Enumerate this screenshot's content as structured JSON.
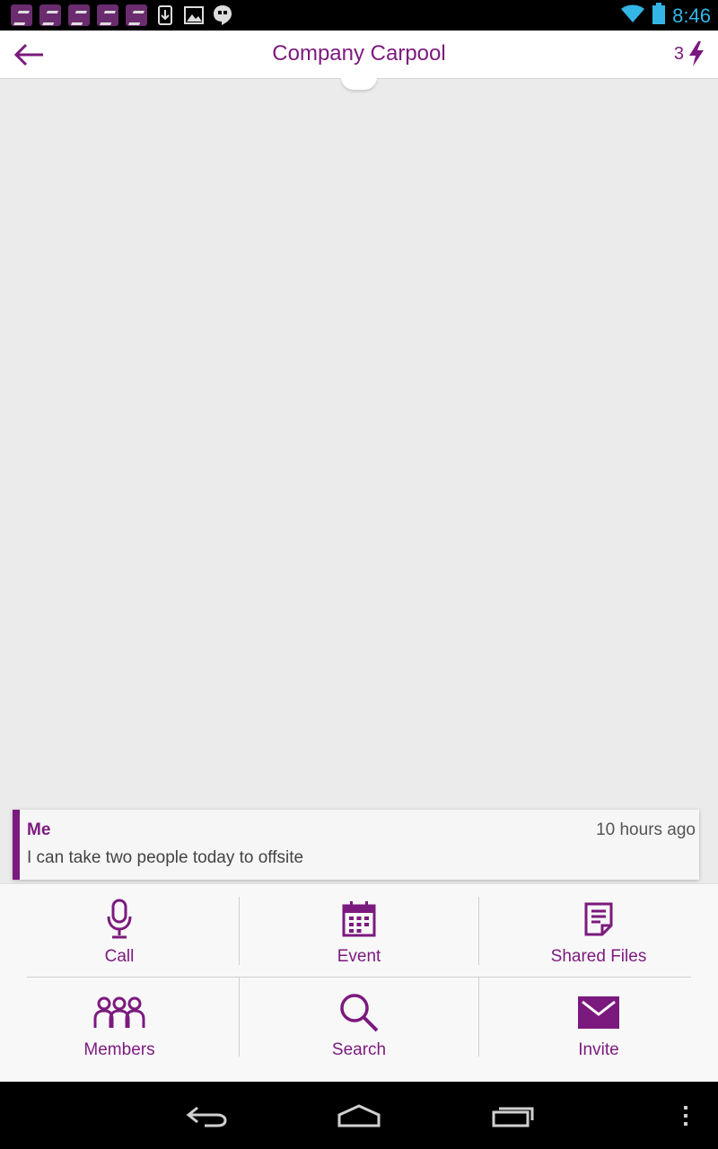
{
  "status_bar": {
    "time": "8:46",
    "notification_icons": [
      "app-notification-icon",
      "app-notification-icon",
      "app-notification-icon",
      "app-notification-icon",
      "app-notification-icon",
      "download-icon",
      "image-icon",
      "hangouts-icon"
    ],
    "system_icons": [
      "wifi-icon",
      "battery-icon"
    ]
  },
  "action_bar": {
    "title": "Company Carpool",
    "badge_count": "3",
    "back_icon": "back-arrow-icon",
    "badge_icon": "lightning-icon"
  },
  "message": {
    "sender": "Me",
    "time": "10 hours ago",
    "text": "I can take two people today to offsite"
  },
  "menu": {
    "items": [
      {
        "label": "Call",
        "icon": "microphone-icon"
      },
      {
        "label": "Event",
        "icon": "calendar-icon"
      },
      {
        "label": "Shared Files",
        "icon": "document-icon"
      },
      {
        "label": "Members",
        "icon": "people-icon"
      },
      {
        "label": "Search",
        "icon": "search-icon"
      },
      {
        "label": "Invite",
        "icon": "envelope-icon"
      }
    ]
  },
  "nav_bar": {
    "buttons": [
      "back-nav-icon",
      "home-icon",
      "recent-apps-icon",
      "overflow-menu-icon"
    ]
  },
  "colors": {
    "accent": "#7b1a7e",
    "background": "#ebebeb",
    "status_time": "#33b5e5"
  }
}
